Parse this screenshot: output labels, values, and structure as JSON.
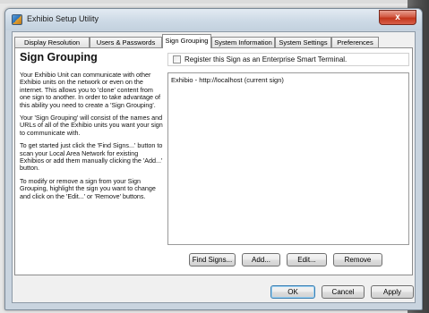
{
  "window": {
    "title": "Exhibio Setup Utility",
    "close_label": "x"
  },
  "tabs": [
    {
      "label": "Display Resolution",
      "active": false
    },
    {
      "label": "Users & Passwords",
      "active": false
    },
    {
      "label": "Sign Grouping",
      "active": true
    },
    {
      "label": "System Information",
      "active": false
    },
    {
      "label": "System Settings",
      "active": false
    },
    {
      "label": "Preferences",
      "active": false
    }
  ],
  "page": {
    "heading": "Sign Grouping",
    "help_paragraphs": [
      "Your Exhibio Unit can communicate with other Exhibio units on the network or even on the internet. This allows you to 'clone' content from one sign to another. In order to take advantage of this ability you need to create a 'Sign Grouping'.",
      "Your 'Sign Grouping' will consist of the names and URLs of all of the Exhibio units you want your sign to communicate with.",
      "To get started just click the 'Find Signs...' button to scan your Local Area Network for existing Exhibios or add them manually clicking the 'Add...' button.",
      "To modify or remove a sign from your Sign Grouping, highlight the sign you want to change and click on the 'Edit...' or 'Remove' buttons."
    ],
    "register": {
      "label": "Register this Sign as an Enterprise Smart Terminal.",
      "checked": false
    },
    "signs": [
      "Exhibio - http://localhost (current sign)"
    ],
    "actions": {
      "find": "Find Signs...",
      "add": "Add...",
      "edit": "Edit...",
      "remove": "Remove"
    }
  },
  "dialog_buttons": {
    "ok": "OK",
    "cancel": "Cancel",
    "apply": "Apply"
  }
}
